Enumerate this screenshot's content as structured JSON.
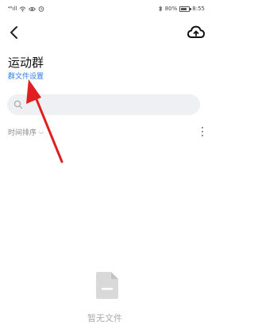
{
  "status_bar": {
    "signal_text": "⁴⁶ıll",
    "battery_text": "80%",
    "time": "8:55",
    "battery_level": 0.8
  },
  "header": {
    "back_icon": "chevron-left-icon",
    "upload_icon": "cloud-upload-icon"
  },
  "group": {
    "title": "运动群",
    "settings_link": "群文件设置"
  },
  "search": {
    "icon": "search-icon",
    "placeholder": ""
  },
  "sort": {
    "label": "时间排序",
    "chevron": "⌵"
  },
  "empty_state": {
    "icon": "file-icon",
    "text": "暂无文件"
  },
  "annotation": {
    "color": "#e02020"
  }
}
